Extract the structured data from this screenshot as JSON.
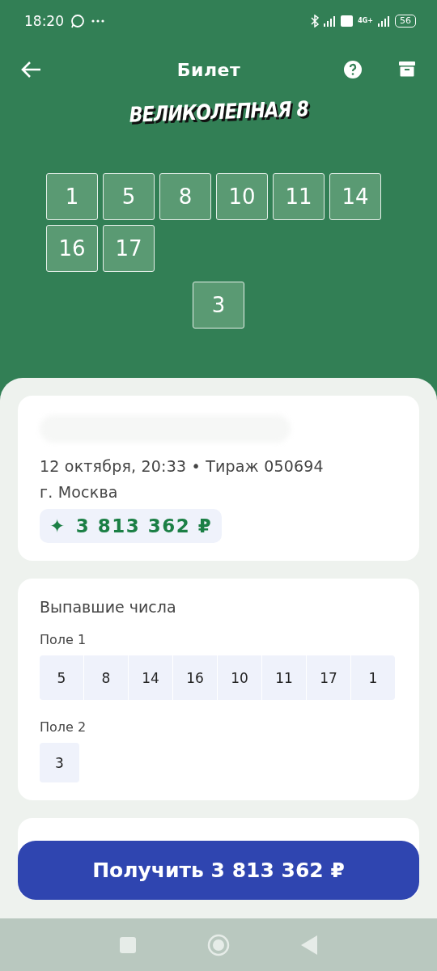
{
  "status_bar": {
    "time": "18:20",
    "battery": "56",
    "network": "4G+"
  },
  "toolbar": {
    "title": "Билет"
  },
  "game_logo": "ВЕЛИКОЛЕПНАЯ 8",
  "ticket_numbers": {
    "field_1": [
      "1",
      "5",
      "8",
      "10",
      "11",
      "14",
      "16",
      "17"
    ],
    "field_2": [
      "3"
    ]
  },
  "ticket_info": {
    "date_draw": "12 октября, 20:33 • Тираж 050694",
    "city": "г. Москва",
    "prize": "3 813 362 ₽",
    "prize_icon": "✦"
  },
  "drawn_numbers": {
    "title": "Выпавшие числа",
    "fields": [
      {
        "label": "Поле 1",
        "numbers": [
          "5",
          "8",
          "14",
          "16",
          "10",
          "11",
          "17",
          "1"
        ]
      },
      {
        "label": "Поле 2",
        "numbers": [
          "3"
        ]
      }
    ]
  },
  "claim_button": {
    "label": "Получить 3 813 362 ₽"
  }
}
